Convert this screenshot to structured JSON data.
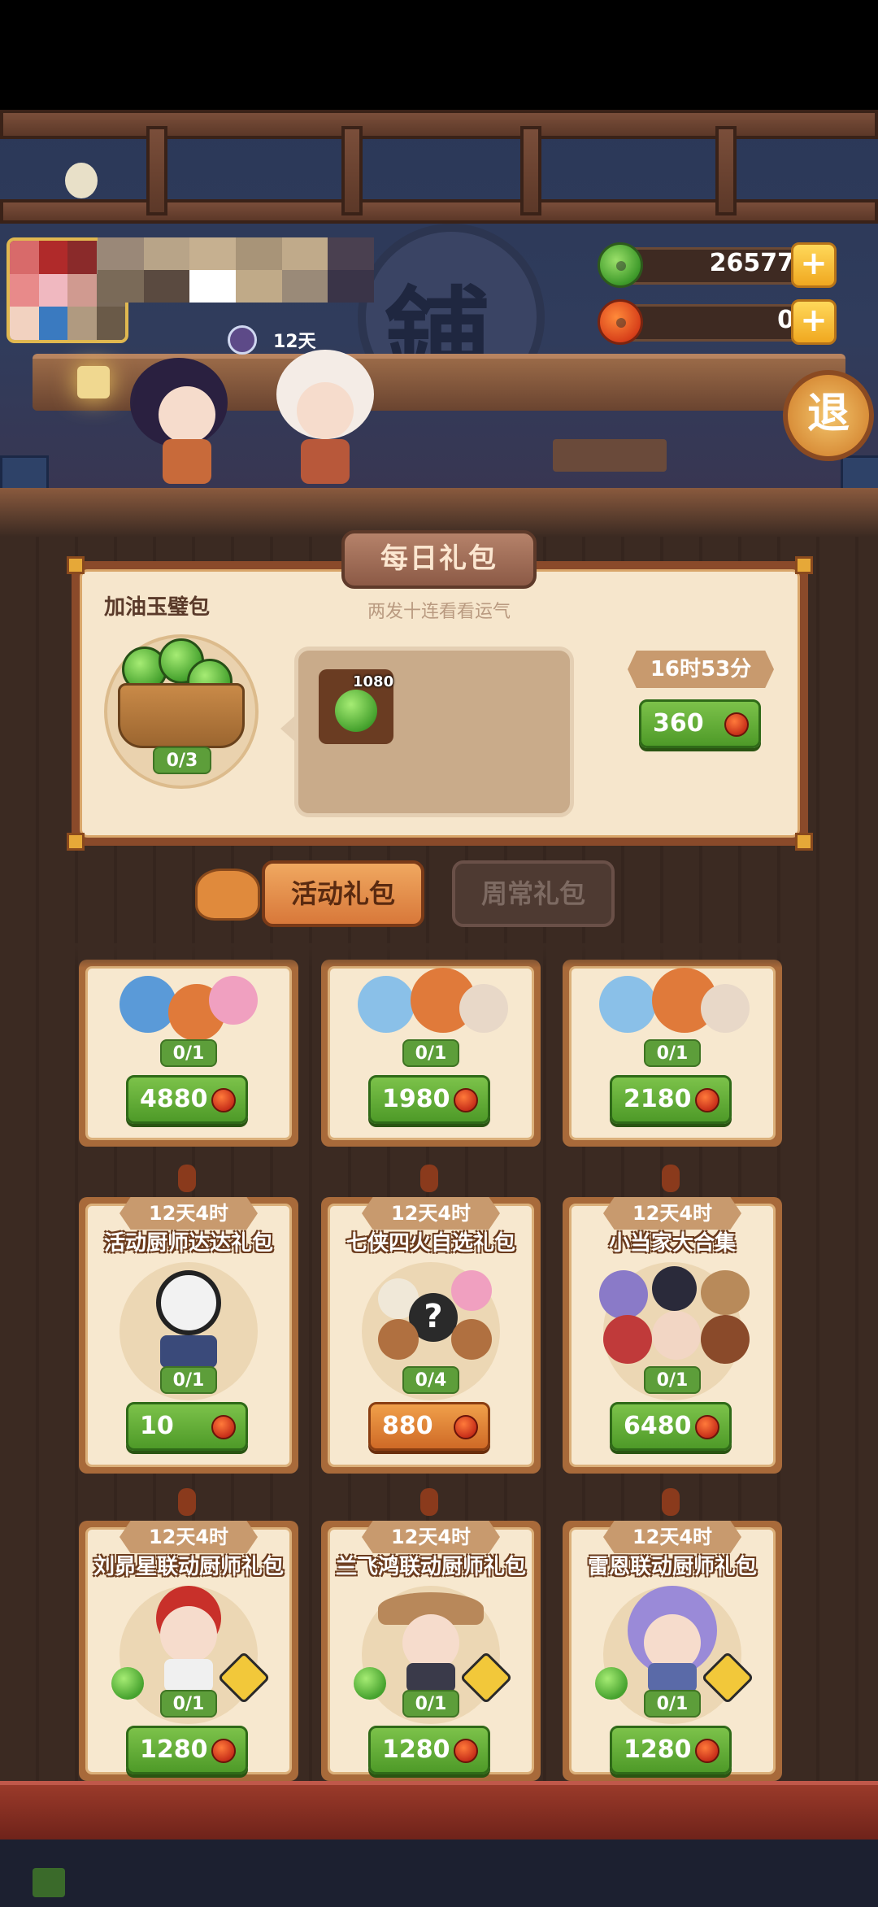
{
  "currency": {
    "jade": {
      "value": "26577",
      "icon": "jade-icon"
    },
    "red": {
      "value": "0",
      "icon": "red-jade-icon"
    },
    "plus_label": "+"
  },
  "scene": {
    "sign_char": "鋪",
    "friend_days": "12天"
  },
  "exit_label": "退",
  "daily": {
    "title": "每日礼包",
    "subtitle": "两发十连看看运气",
    "pack_name": "加油玉璧包",
    "progress": "0/3",
    "item_count": "1080",
    "timer": "16时53分",
    "price": "360"
  },
  "tabs": {
    "active": "活动礼包",
    "inactive": "周常礼包"
  },
  "cards": {
    "row1": [
      {
        "progress": "0/1",
        "price": "4880"
      },
      {
        "progress": "0/1",
        "price": "1980"
      },
      {
        "progress": "0/1",
        "price": "2180"
      }
    ],
    "row2": [
      {
        "timer": "12天4时",
        "name": "活动厨师达达礼包",
        "progress": "0/1",
        "price": "10"
      },
      {
        "timer": "12天4时",
        "name": "七侠四火自选礼包",
        "progress": "0/4",
        "price": "880"
      },
      {
        "timer": "12天4时",
        "name": "小当家大合集",
        "progress": "0/1",
        "price": "6480"
      }
    ],
    "row3": [
      {
        "timer": "12天4时",
        "name": "刘昴星联动厨师礼包",
        "progress": "0/1",
        "price": "1280"
      },
      {
        "timer": "12天4时",
        "name": "兰飞鸿联动厨师礼包",
        "progress": "0/1",
        "price": "1280"
      },
      {
        "timer": "12天4时",
        "name": "雷恩联动厨师礼包",
        "progress": "0/1",
        "price": "1280"
      }
    ]
  },
  "colors": {
    "green_button": "#5ea82e",
    "orange_button": "#d8783a",
    "wood": "#3b2a22"
  }
}
